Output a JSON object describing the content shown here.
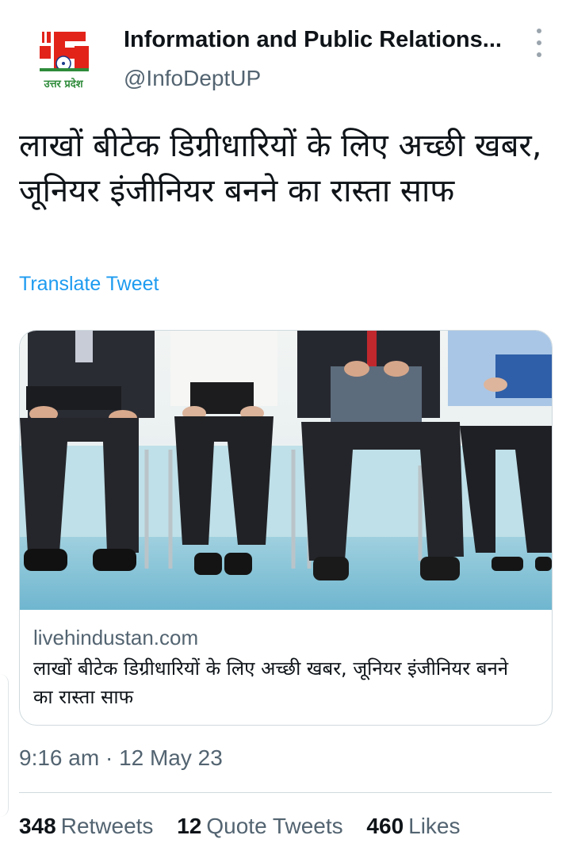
{
  "author": {
    "name": "Information and Public Relations...",
    "handle": "@InfoDeptUP",
    "avatar_label": "उत्तर प्रदेश",
    "avatar_icon": "up-govt-logo"
  },
  "menu_icon": "more-vertical-icon",
  "tweet": {
    "text": "लाखों बीटेक डिग्रीधारियों के लिए अच्छी खबर, जूनियर इंजीनियर बनने का रास्ता साफ",
    "translate_label": "Translate Tweet"
  },
  "card": {
    "image_description_icon": "link-preview-image",
    "domain": "livehindustan.com",
    "title": "लाखों बीटेक डिग्रीधारियों के लिए अच्छी खबर, जूनियर इंजीनियर बनने का रास्ता साफ"
  },
  "meta": {
    "time": "9:16 am",
    "separator": "·",
    "date": "12 May 23"
  },
  "stats": {
    "retweets_count": "348",
    "retweets_label": "Retweets",
    "quotes_count": "12",
    "quotes_label": "Quote Tweets",
    "likes_count": "460",
    "likes_label": "Likes"
  },
  "colors": {
    "accent": "#1d9bf0",
    "text_primary": "#0f1419",
    "text_secondary": "#536471",
    "border": "#cfd9de",
    "logo_red": "#e2231a",
    "logo_green": "#2e8b3a"
  }
}
